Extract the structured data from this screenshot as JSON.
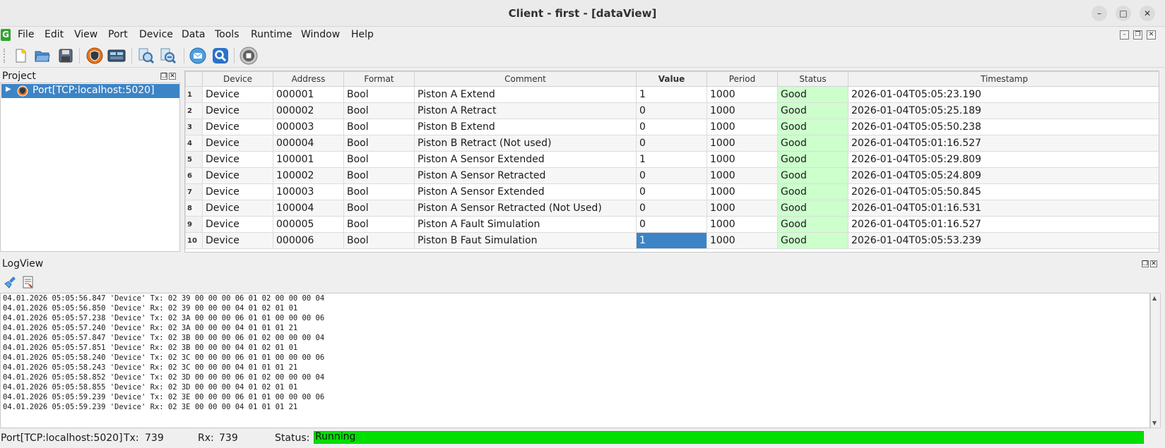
{
  "window": {
    "title": "Client - first  - [dataView]"
  },
  "menu": [
    "File",
    "Edit",
    "View",
    "Port",
    "Device",
    "Data",
    "Tools",
    "Runtime",
    "Window",
    "Help"
  ],
  "project": {
    "title": "Project",
    "tree_item": "Port[TCP:localhost:5020]"
  },
  "table": {
    "columns": [
      "Device",
      "Address",
      "Format",
      "Comment",
      "Value",
      "Period",
      "Status",
      "Timestamp"
    ],
    "rows": [
      {
        "num": "1",
        "device": "Device",
        "address": "000001",
        "format": "Bool",
        "comment": "Piston A Extend",
        "value": "1",
        "period": "1000",
        "status": "Good",
        "timestamp": "2026-01-04T05:05:23.190"
      },
      {
        "num": "2",
        "device": "Device",
        "address": "000002",
        "format": "Bool",
        "comment": "Piston A Retract",
        "value": "0",
        "period": "1000",
        "status": "Good",
        "timestamp": "2026-01-04T05:05:25.189"
      },
      {
        "num": "3",
        "device": "Device",
        "address": "000003",
        "format": "Bool",
        "comment": "Piston B Extend",
        "value": "0",
        "period": "1000",
        "status": "Good",
        "timestamp": "2026-01-04T05:05:50.238"
      },
      {
        "num": "4",
        "device": "Device",
        "address": "000004",
        "format": "Bool",
        "comment": "Piston B Retract (Not used)",
        "value": "0",
        "period": "1000",
        "status": "Good",
        "timestamp": "2026-01-04T05:01:16.527"
      },
      {
        "num": "5",
        "device": "Device",
        "address": "100001",
        "format": "Bool",
        "comment": "Piston A Sensor Extended",
        "value": "1",
        "period": "1000",
        "status": "Good",
        "timestamp": "2026-01-04T05:05:29.809"
      },
      {
        "num": "6",
        "device": "Device",
        "address": "100002",
        "format": "Bool",
        "comment": "Piston A Sensor Retracted",
        "value": "0",
        "period": "1000",
        "status": "Good",
        "timestamp": "2026-01-04T05:05:24.809"
      },
      {
        "num": "7",
        "device": "Device",
        "address": "100003",
        "format": "Bool",
        "comment": "Piston A Sensor Extended",
        "value": "0",
        "period": "1000",
        "status": "Good",
        "timestamp": "2026-01-04T05:05:50.845"
      },
      {
        "num": "8",
        "device": "Device",
        "address": "100004",
        "format": "Bool",
        "comment": "Piston A Sensor Retracted (Not Used)",
        "value": "0",
        "period": "1000",
        "status": "Good",
        "timestamp": "2026-01-04T05:01:16.531"
      },
      {
        "num": "9",
        "device": "Device",
        "address": "000005",
        "format": "Bool",
        "comment": "Piston A Fault Simulation",
        "value": "0",
        "period": "1000",
        "status": "Good",
        "timestamp": "2026-01-04T05:01:16.527"
      },
      {
        "num": "10",
        "device": "Device",
        "address": "000006",
        "format": "Bool",
        "comment": "Piston B Faut Simulation",
        "value": "1",
        "period": "1000",
        "status": "Good",
        "timestamp": "2026-01-04T05:05:53.239"
      }
    ]
  },
  "logview": {
    "title": "LogView",
    "lines": [
      "04.01.2026 05:05:56.847 'Device' Tx: 02 39 00 00 00 06 01 02 00 00 00 04",
      "04.01.2026 05:05:56.850 'Device' Rx: 02 39 00 00 00 04 01 02 01 01",
      "04.01.2026 05:05:57.238 'Device' Tx: 02 3A 00 00 00 06 01 01 00 00 00 06",
      "04.01.2026 05:05:57.240 'Device' Rx: 02 3A 00 00 00 04 01 01 01 21",
      "04.01.2026 05:05:57.847 'Device' Tx: 02 3B 00 00 00 06 01 02 00 00 00 04",
      "04.01.2026 05:05:57.851 'Device' Rx: 02 3B 00 00 00 04 01 02 01 01",
      "04.01.2026 05:05:58.240 'Device' Tx: 02 3C 00 00 00 06 01 01 00 00 00 06",
      "04.01.2026 05:05:58.243 'Device' Rx: 02 3C 00 00 00 04 01 01 01 21",
      "04.01.2026 05:05:58.852 'Device' Tx: 02 3D 00 00 00 06 01 02 00 00 00 04",
      "04.01.2026 05:05:58.855 'Device' Rx: 02 3D 00 00 00 04 01 02 01 01",
      "04.01.2026 05:05:59.239 'Device' Tx: 02 3E 00 00 00 06 01 01 00 00 00 06",
      "04.01.2026 05:05:59.239 'Device' Rx: 02 3E 00 00 00 04 01 01 01 21"
    ]
  },
  "status": {
    "port": "Port[TCP:localhost:5020]",
    "tx_label": "Tx:",
    "tx": "739",
    "rx_label": "Rx:",
    "rx": "739",
    "status_label": "Status:",
    "status": "Running"
  },
  "icons": {
    "toolbar": [
      "new-file-icon",
      "open-folder-icon",
      "save-icon",
      "port-shield-icon",
      "device-icon",
      "zoom-icon",
      "zoom-out-icon",
      "mail-icon",
      "search-icon",
      "stop-icon"
    ],
    "log": [
      "clear-brush-icon",
      "export-log-icon"
    ]
  },
  "colors": {
    "selection": "#3d84c6",
    "status_good": "#ccffcc",
    "running_bar": "#00e000"
  }
}
